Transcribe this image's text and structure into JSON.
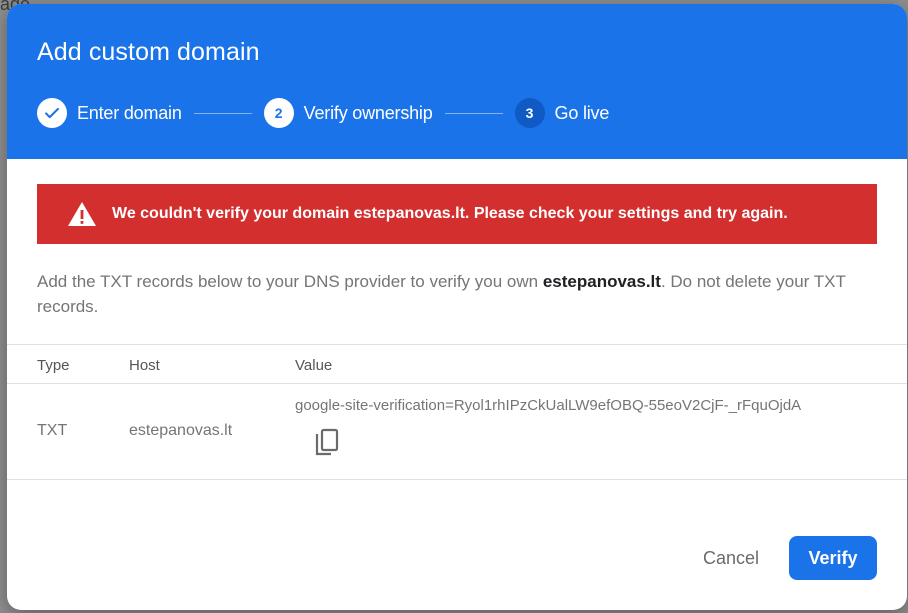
{
  "backdrop": {
    "partial_text": "age"
  },
  "dialog": {
    "title": "Add custom domain",
    "steps": [
      {
        "number": "",
        "label": "Enter domain",
        "state": "done"
      },
      {
        "number": "2",
        "label": "Verify ownership",
        "state": "active"
      },
      {
        "number": "3",
        "label": "Go live",
        "state": "pending"
      }
    ],
    "alert": {
      "message": "We couldn't verify your domain estepanovas.lt. Please check your settings and try again.",
      "color": "#d32f2f"
    },
    "instructions": {
      "before": "Add the TXT records below to your DNS provider to verify you own ",
      "domain": "estepanovas.lt",
      "after": ". Do not delete your TXT records."
    },
    "table": {
      "headers": {
        "type": "Type",
        "host": "Host",
        "value": "Value"
      },
      "rows": [
        {
          "type": "TXT",
          "host": "estepanovas.lt",
          "value": "google-site-verification=Ryol1rhIPzCkUalLW9efOBQ-55eoV2CjF-_rFquOjdA"
        }
      ]
    },
    "actions": {
      "cancel": "Cancel",
      "verify": "Verify"
    }
  },
  "colors": {
    "primary": "#1a73e8",
    "error": "#d32f2f",
    "pending_step": "#0f5ac4"
  }
}
